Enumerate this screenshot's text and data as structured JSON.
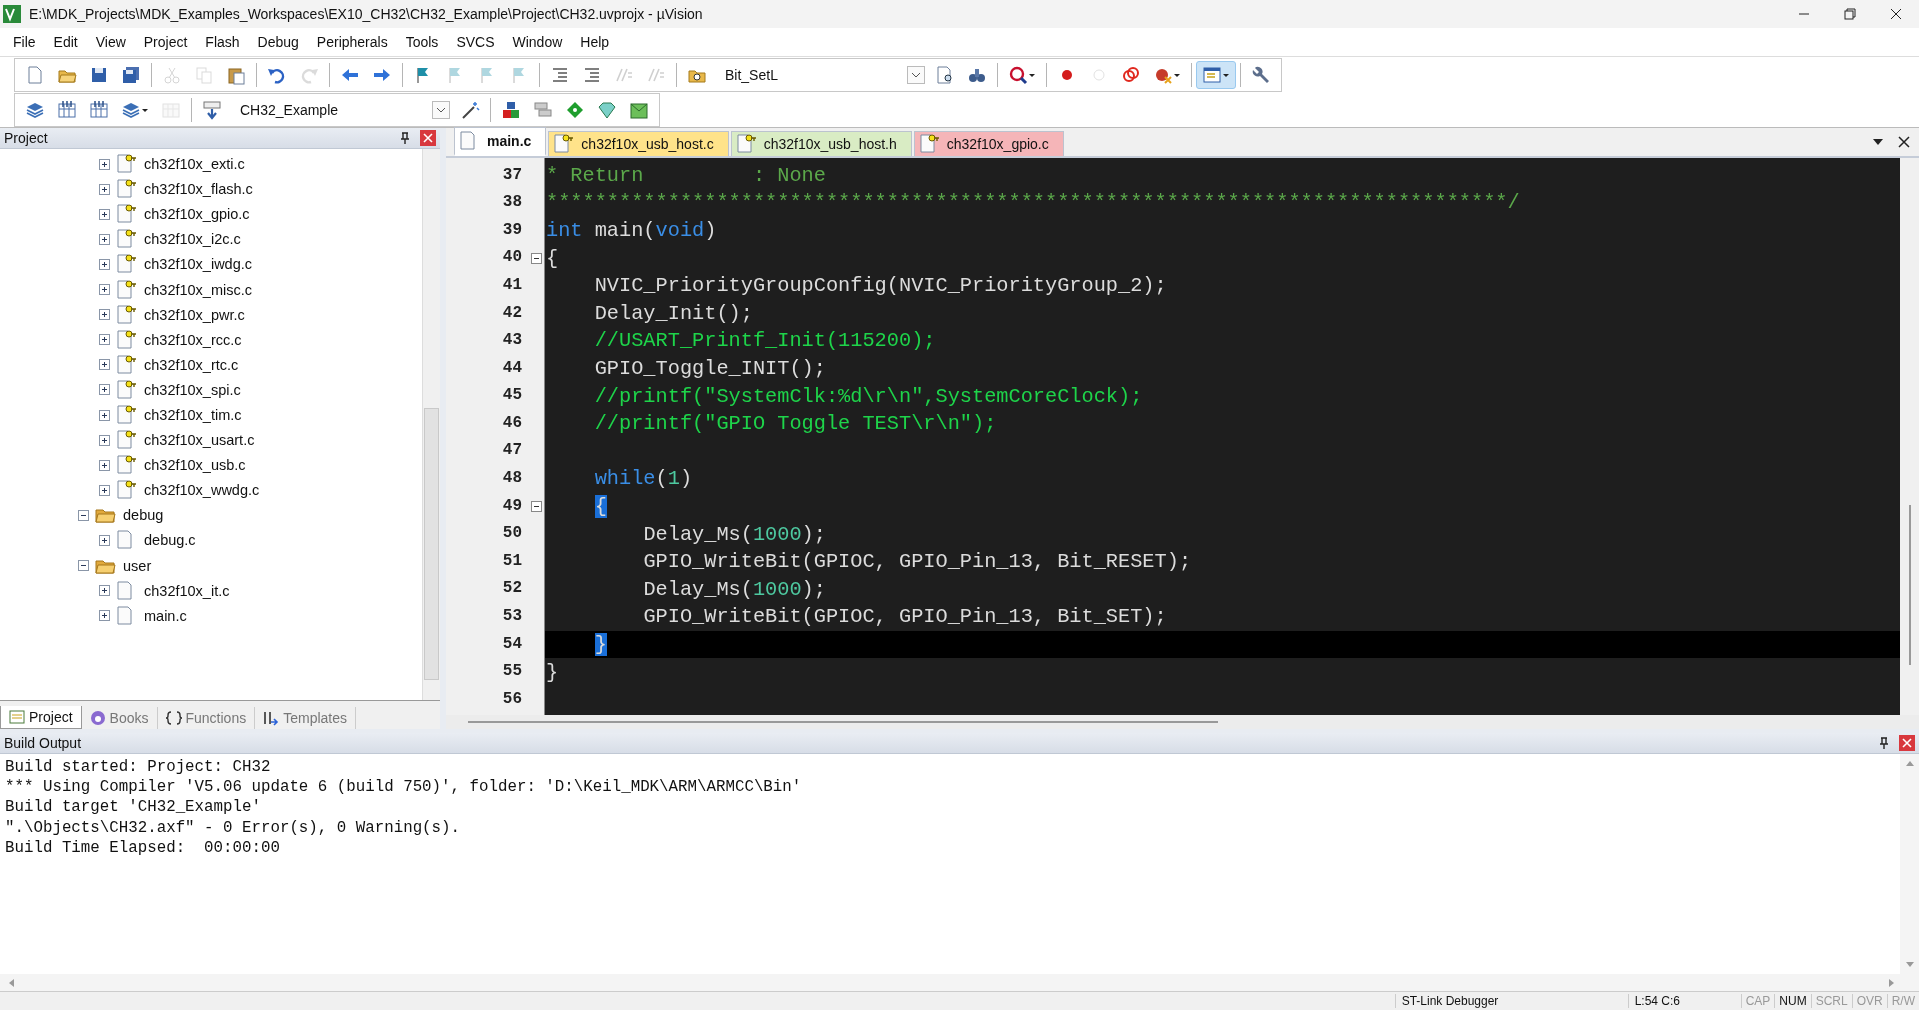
{
  "window": {
    "title": "E:\\MDK_Projects\\MDK_Examples_Workspaces\\EX10_CH32\\CH32_Example\\Project\\CH32.uvprojx - µVision"
  },
  "menu": [
    "File",
    "Edit",
    "View",
    "Project",
    "Flash",
    "Debug",
    "Peripherals",
    "Tools",
    "SVCS",
    "Window",
    "Help"
  ],
  "toolbar_1": [
    {
      "kind": "button",
      "disabled": false
    },
    {
      "kind": "button",
      "disabled": false
    },
    {
      "kind": "button",
      "disabled": false
    },
    {
      "kind": "button",
      "disabled": false
    },
    {
      "kind": "separator"
    },
    {
      "kind": "button",
      "disabled": true
    },
    {
      "kind": "button",
      "disabled": true
    },
    {
      "kind": "button",
      "disabled": false
    },
    {
      "kind": "separator"
    },
    {
      "kind": "button",
      "disabled": false
    },
    {
      "kind": "button",
      "disabled": true
    },
    {
      "kind": "separator"
    },
    {
      "kind": "button",
      "disabled": false
    },
    {
      "kind": "button",
      "disabled": false
    },
    {
      "kind": "separator"
    },
    {
      "kind": "button",
      "disabled": false
    },
    {
      "kind": "button",
      "disabled": true
    },
    {
      "kind": "button",
      "disabled": true
    },
    {
      "kind": "button",
      "disabled": true
    },
    {
      "kind": "separator"
    },
    {
      "kind": "button",
      "disabled": false
    },
    {
      "kind": "button",
      "disabled": false
    },
    {
      "kind": "button",
      "disabled": true
    },
    {
      "kind": "button",
      "disabled": true
    },
    {
      "kind": "separator"
    },
    {
      "kind": "button",
      "disabled": false
    },
    {
      "kind": "combo",
      "value": "Bit_SetL"
    },
    {
      "kind": "button",
      "disabled": false
    },
    {
      "kind": "button",
      "disabled": false
    },
    {
      "kind": "separator"
    },
    {
      "kind": "dropdown",
      "disabled": false,
      "selected": false
    },
    {
      "kind": "separator"
    },
    {
      "kind": "button",
      "disabled": false
    },
    {
      "kind": "button",
      "disabled": true
    },
    {
      "kind": "button",
      "disabled": false
    },
    {
      "kind": "dropdown",
      "disabled": false,
      "selected": false
    },
    {
      "kind": "separator"
    },
    {
      "kind": "dropdown",
      "disabled": false,
      "selected": true
    },
    {
      "kind": "separator"
    },
    {
      "kind": "button",
      "disabled": false
    }
  ],
  "toolbar_2": [
    {
      "kind": "button",
      "disabled": false
    },
    {
      "kind": "button",
      "disabled": false
    },
    {
      "kind": "button",
      "disabled": false
    },
    {
      "kind": "dropdown",
      "disabled": false,
      "selected": false
    },
    {
      "kind": "button",
      "disabled": true
    },
    {
      "kind": "separator"
    },
    {
      "kind": "button",
      "disabled": false
    },
    {
      "kind": "combo",
      "value": "CH32_Example"
    },
    {
      "kind": "button",
      "disabled": false
    },
    {
      "kind": "separator"
    },
    {
      "kind": "button",
      "disabled": false
    },
    {
      "kind": "button",
      "disabled": false
    },
    {
      "kind": "button",
      "disabled": false
    },
    {
      "kind": "button",
      "disabled": false
    },
    {
      "kind": "button",
      "disabled": false
    }
  ],
  "project_panel": {
    "title": "Project",
    "tree": [
      {
        "kind": "offscreen-group",
        "children": [
          {
            "label": "ch32f10x_exti.c",
            "read_only": true,
            "expanded": false
          },
          {
            "label": "ch32f10x_flash.c",
            "read_only": true,
            "expanded": false
          },
          {
            "label": "ch32f10x_gpio.c",
            "read_only": true,
            "expanded": false
          },
          {
            "label": "ch32f10x_i2c.c",
            "read_only": true,
            "expanded": false
          },
          {
            "label": "ch32f10x_iwdg.c",
            "read_only": true,
            "expanded": false
          },
          {
            "label": "ch32f10x_misc.c",
            "read_only": true,
            "expanded": false
          },
          {
            "label": "ch32f10x_pwr.c",
            "read_only": true,
            "expanded": false
          },
          {
            "label": "ch32f10x_rcc.c",
            "read_only": true,
            "expanded": false
          },
          {
            "label": "ch32f10x_rtc.c",
            "read_only": true,
            "expanded": false
          },
          {
            "label": "ch32f10x_spi.c",
            "read_only": true,
            "expanded": false
          },
          {
            "label": "ch32f10x_tim.c",
            "read_only": true,
            "expanded": false
          },
          {
            "label": "ch32f10x_usart.c",
            "read_only": true,
            "expanded": false
          },
          {
            "label": "ch32f10x_usb.c",
            "read_only": true,
            "expanded": false
          },
          {
            "label": "ch32f10x_wwdg.c",
            "read_only": true,
            "expanded": false
          }
        ]
      },
      {
        "kind": "folder",
        "label": "debug",
        "expanded": true,
        "children": [
          {
            "label": "debug.c",
            "read_only": false,
            "expanded": false
          }
        ]
      },
      {
        "kind": "folder",
        "label": "user",
        "expanded": true,
        "children": [
          {
            "label": "ch32f10x_it.c",
            "read_only": false,
            "expanded": false
          },
          {
            "label": "main.c",
            "read_only": false,
            "expanded": false
          }
        ]
      }
    ],
    "tabs": [
      {
        "label": "Project",
        "selected": true
      },
      {
        "label": "Books",
        "selected": false
      },
      {
        "label": "Functions",
        "selected": false
      },
      {
        "label": "Templates",
        "selected": false
      }
    ]
  },
  "editor": {
    "tabs": [
      {
        "label": "main.c",
        "selected": true,
        "read_only": false,
        "color": "#ffffff"
      },
      {
        "label": "ch32f10x_usb_host.c",
        "selected": false,
        "read_only": true,
        "color": "#ffe38a"
      },
      {
        "label": "ch32f10x_usb_host.h",
        "selected": false,
        "read_only": true,
        "color": "#d9ecc4"
      },
      {
        "label": "ch32f10x_gpio.c",
        "selected": false,
        "read_only": true,
        "color": "#f5b5b8"
      }
    ],
    "lines": [
      {
        "number": "37",
        "tokens": [
          {
            "kind": "block-comment",
            "text": "* Return         : None"
          }
        ]
      },
      {
        "number": "38",
        "tokens": [
          {
            "kind": "block-comment",
            "text": "*******************************************************************************/"
          }
        ]
      },
      {
        "number": "39",
        "tokens": [
          {
            "kind": "keyword",
            "text": "int"
          },
          {
            "kind": "plain",
            "text": " main("
          },
          {
            "kind": "keyword",
            "text": "void"
          },
          {
            "kind": "plain",
            "text": ")"
          }
        ]
      },
      {
        "number": "40",
        "fold": true,
        "tokens": [
          {
            "kind": "plain",
            "text": "{"
          }
        ]
      },
      {
        "number": "41",
        "tokens": [
          {
            "kind": "plain",
            "text": "    NVIC_PriorityGroupConfig(NVIC_PriorityGroup_2);"
          }
        ]
      },
      {
        "number": "42",
        "tokens": [
          {
            "kind": "plain",
            "text": "    Delay_Init();"
          }
        ]
      },
      {
        "number": "43",
        "tokens": [
          {
            "kind": "line-comment",
            "text": "    //USART_Printf_Init(115200);"
          }
        ]
      },
      {
        "number": "44",
        "tokens": [
          {
            "kind": "plain",
            "text": "    GPIO_Toggle_INIT();"
          }
        ]
      },
      {
        "number": "45",
        "tokens": [
          {
            "kind": "line-comment",
            "text": "    //printf(\"SystemClk:%d\\r\\n\",SystemCoreClock);"
          }
        ]
      },
      {
        "number": "46",
        "tokens": [
          {
            "kind": "line-comment",
            "text": "    //printf(\"GPIO Toggle TEST\\r\\n\");"
          }
        ]
      },
      {
        "number": "47"
      },
      {
        "number": "48",
        "tokens": [
          {
            "kind": "keyword",
            "text": "    while"
          },
          {
            "kind": "plain",
            "text": "("
          },
          {
            "kind": "number",
            "text": "1"
          },
          {
            "kind": "plain",
            "text": ")"
          }
        ]
      },
      {
        "number": "49",
        "fold": true,
        "tokens": [
          {
            "kind": "brace-match",
            "text": "    {"
          }
        ]
      },
      {
        "number": "50",
        "tokens": [
          {
            "kind": "plain",
            "text": "        Delay_Ms("
          },
          {
            "kind": "number",
            "text": "1000"
          },
          {
            "kind": "plain",
            "text": ");"
          }
        ]
      },
      {
        "number": "51",
        "tokens": [
          {
            "kind": "plain",
            "text": "        GPIO_WriteBit(GPIOC, GPIO_Pin_13, Bit_RESET);"
          }
        ]
      },
      {
        "number": "52",
        "tokens": [
          {
            "kind": "plain",
            "text": "        Delay_Ms("
          },
          {
            "kind": "number",
            "text": "1000"
          },
          {
            "kind": "plain",
            "text": ");"
          }
        ]
      },
      {
        "number": "53",
        "tokens": [
          {
            "kind": "plain",
            "text": "        GPIO_WriteBit(GPIOC, GPIO_Pin_13, Bit_SET);"
          }
        ]
      },
      {
        "number": "54",
        "current": true,
        "tokens": [
          {
            "kind": "brace-match",
            "text": "    }"
          }
        ]
      },
      {
        "number": "55",
        "tokens": [
          {
            "kind": "plain",
            "text": "}"
          }
        ]
      },
      {
        "number": "56"
      }
    ]
  },
  "build_output": {
    "title": "Build Output",
    "lines": [
      "Build started: Project: CH32",
      "*** Using Compiler 'V5.06 update 6 (build 750)', folder: 'D:\\Keil_MDK\\ARM\\ARMCC\\Bin'",
      "Build target 'CH32_Example'",
      "\".\\Objects\\CH32.axf\" - 0 Error(s), 0 Warning(s).",
      "Build Time Elapsed:  00:00:00"
    ]
  },
  "status_bar": {
    "debugger": "ST-Link Debugger",
    "position": "L:54 C:6",
    "indicators": [
      {
        "label": "CAP",
        "on": false
      },
      {
        "label": "NUM",
        "on": true
      },
      {
        "label": "SCRL",
        "on": false
      },
      {
        "label": "OVR",
        "on": false
      },
      {
        "label": "R/W",
        "on": false
      }
    ]
  }
}
